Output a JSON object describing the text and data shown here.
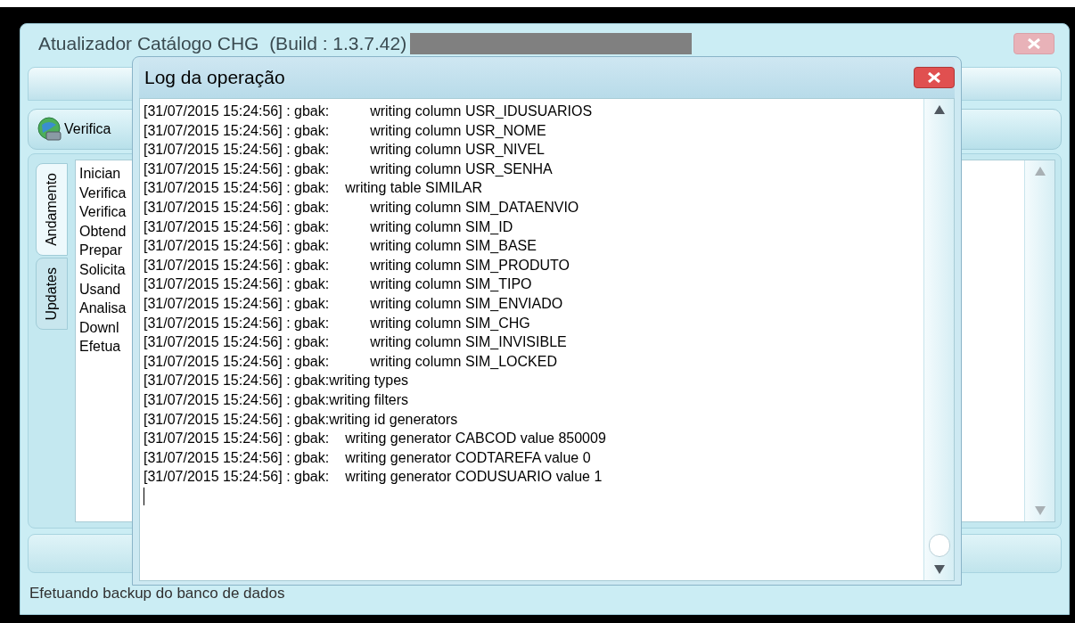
{
  "window": {
    "title": "Atualizador Catálogo CHG  (Build : 1.3.7.42)"
  },
  "toolbar": {
    "button": "Verifica"
  },
  "tabs": [
    {
      "label": "Andamento",
      "selected": true
    },
    {
      "label": "Updates",
      "selected": false
    }
  ],
  "progress_list": [
    "Inician",
    "Verifica",
    "Verifica",
    "Obtend",
    "Prepar",
    "Solicita",
    "Usand",
    "Analisa",
    "Downl",
    "Efetua"
  ],
  "status_bar": "Efetuando backup do banco de dados",
  "dialog": {
    "title": "Log da operação",
    "lines": [
      {
        "prefix": "[31/07/2015 15:24:56] : gbak:",
        "kind": "column",
        "message": "writing column USR_IDUSUARIOS"
      },
      {
        "prefix": "[31/07/2015 15:24:56] : gbak:",
        "kind": "column",
        "message": "writing column USR_NOME"
      },
      {
        "prefix": "[31/07/2015 15:24:56] : gbak:",
        "kind": "column",
        "message": "writing column USR_NIVEL"
      },
      {
        "prefix": "[31/07/2015 15:24:56] : gbak:",
        "kind": "column",
        "message": "writing column USR_SENHA"
      },
      {
        "prefix": "[31/07/2015 15:24:56] : gbak:",
        "kind": "object",
        "message": "writing table SIMILAR"
      },
      {
        "prefix": "[31/07/2015 15:24:56] : gbak:",
        "kind": "column",
        "message": "writing column SIM_DATAENVIO"
      },
      {
        "prefix": "[31/07/2015 15:24:56] : gbak:",
        "kind": "column",
        "message": "writing column SIM_ID"
      },
      {
        "prefix": "[31/07/2015 15:24:56] : gbak:",
        "kind": "column",
        "message": "writing column SIM_BASE"
      },
      {
        "prefix": "[31/07/2015 15:24:56] : gbak:",
        "kind": "column",
        "message": "writing column SIM_PRODUTO"
      },
      {
        "prefix": "[31/07/2015 15:24:56] : gbak:",
        "kind": "column",
        "message": "writing column SIM_TIPO"
      },
      {
        "prefix": "[31/07/2015 15:24:56] : gbak:",
        "kind": "column",
        "message": "writing column SIM_ENVIADO"
      },
      {
        "prefix": "[31/07/2015 15:24:56] : gbak:",
        "kind": "column",
        "message": "writing column SIM_CHG"
      },
      {
        "prefix": "[31/07/2015 15:24:56] : gbak:",
        "kind": "column",
        "message": "writing column SIM_INVISIBLE"
      },
      {
        "prefix": "[31/07/2015 15:24:56] : gbak:",
        "kind": "column",
        "message": "writing column SIM_LOCKED"
      },
      {
        "prefix": "[31/07/2015 15:24:56] : gbak:",
        "kind": "section",
        "message": "writing types"
      },
      {
        "prefix": "[31/07/2015 15:24:56] : gbak:",
        "kind": "section",
        "message": "writing filters"
      },
      {
        "prefix": "[31/07/2015 15:24:56] : gbak:",
        "kind": "section",
        "message": "writing id generators"
      },
      {
        "prefix": "[31/07/2015 15:24:56] : gbak:",
        "kind": "object",
        "message": "writing generator CABCOD value 850009"
      },
      {
        "prefix": "[31/07/2015 15:24:56] : gbak:",
        "kind": "object",
        "message": "writing generator CODTAREFA value 0"
      },
      {
        "prefix": "[31/07/2015 15:24:56] : gbak:",
        "kind": "object",
        "message": "writing generator CODUSUARIO value 1"
      }
    ]
  }
}
